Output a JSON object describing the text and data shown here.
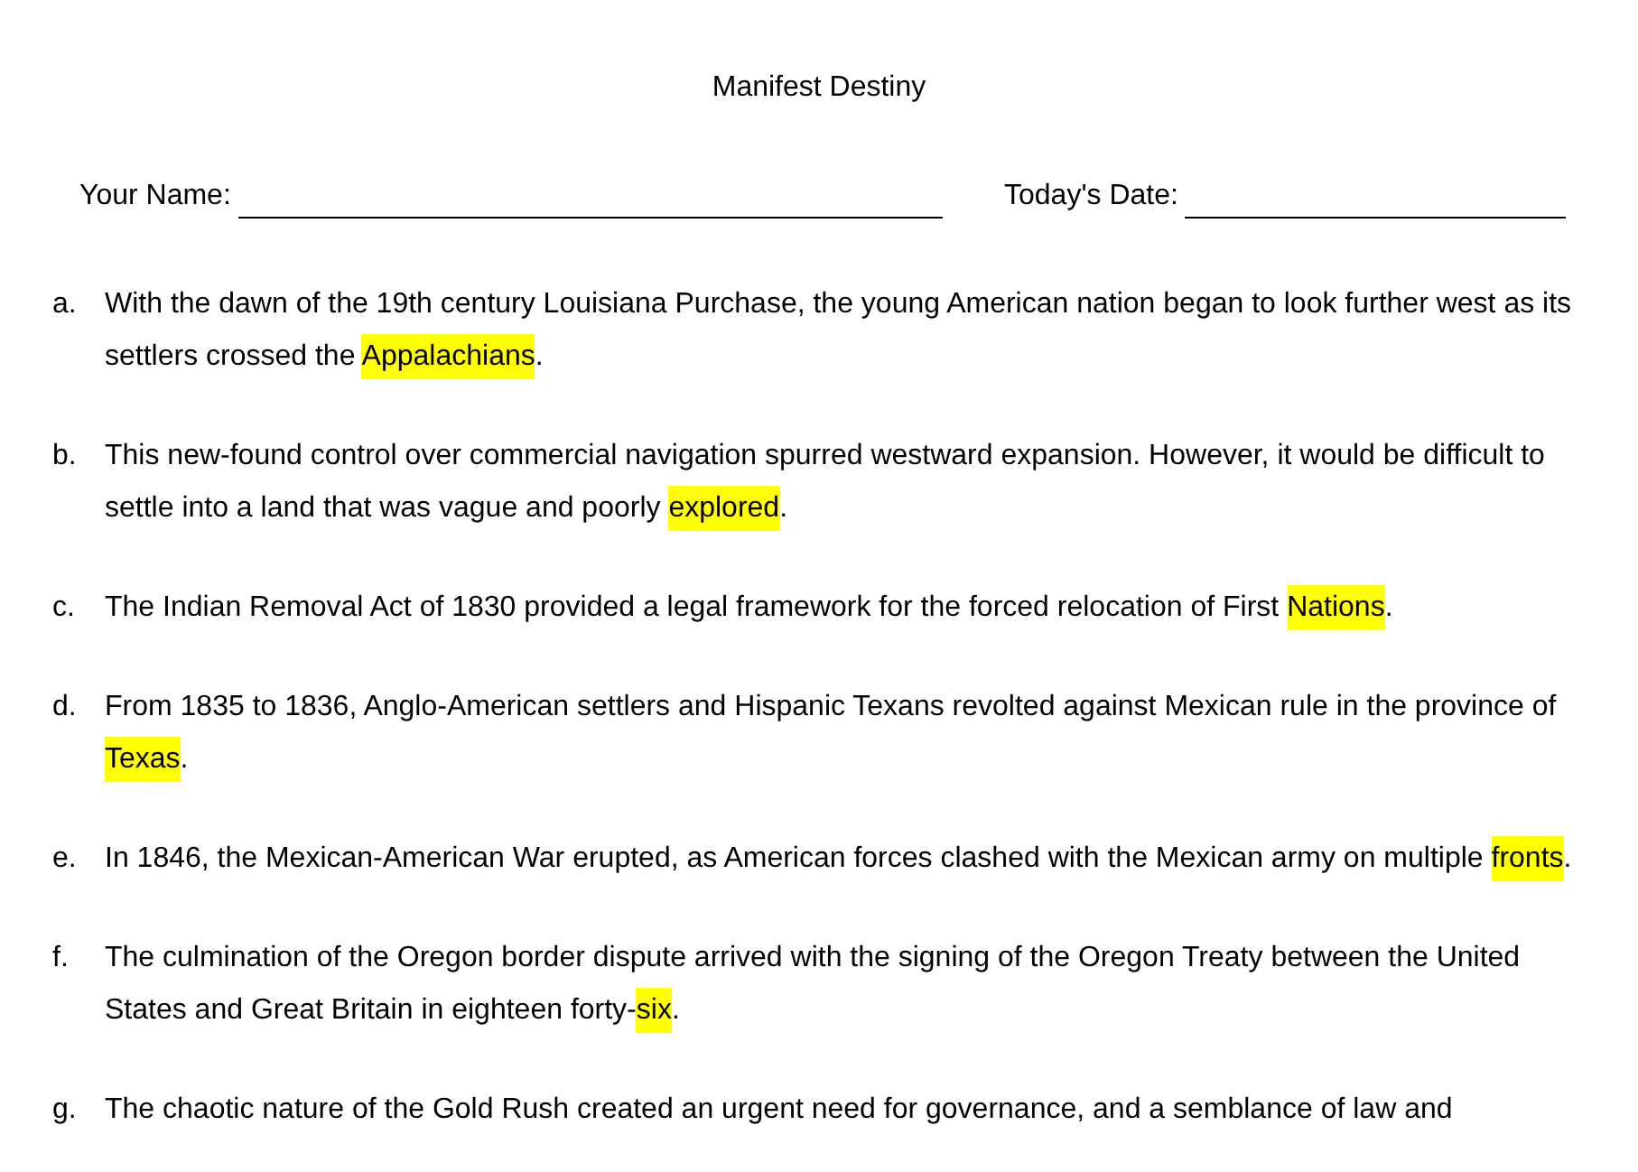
{
  "title": "Manifest Destiny",
  "fields": [
    {
      "label": "Your Name:"
    },
    {
      "label": "Today's Date:"
    }
  ],
  "items": [
    {
      "letter": "a.",
      "before": "With the dawn of the 19th century Louisiana Purchase, the young American nation began to look further west as its settlers crossed the ",
      "highlight": "Appalachians",
      "after": "."
    },
    {
      "letter": "b.",
      "before": "This new-found control over commercial navigation spurred westward expansion. However, it would be difficult to settle into a land that was vague and poorly ",
      "highlight": "explored",
      "after": "."
    },
    {
      "letter": "c.",
      "before": "The Indian Removal Act of 1830 provided a legal framework for the forced relocation of First ",
      "highlight": "Nations",
      "after": "."
    },
    {
      "letter": "d.",
      "before": "From 1835 to 1836, Anglo-American settlers and Hispanic Texans revolted against Mexican rule in the province of ",
      "highlight": "Texas",
      "after": "."
    },
    {
      "letter": "e.",
      "before": "In 1846, the Mexican-American War erupted, as American forces clashed with the Mexican army on multiple ",
      "highlight": "fronts",
      "after": "."
    },
    {
      "letter": "f.",
      "before": "The culmination of the Oregon border dispute arrived with the signing of the Oregon Treaty between the United States and Great Britain in eighteen forty-",
      "highlight": "six",
      "after": "."
    },
    {
      "letter": "g.",
      "before": "The chaotic nature of the Gold Rush created an urgent need for governance, and a semblance of law and"
    }
  ]
}
